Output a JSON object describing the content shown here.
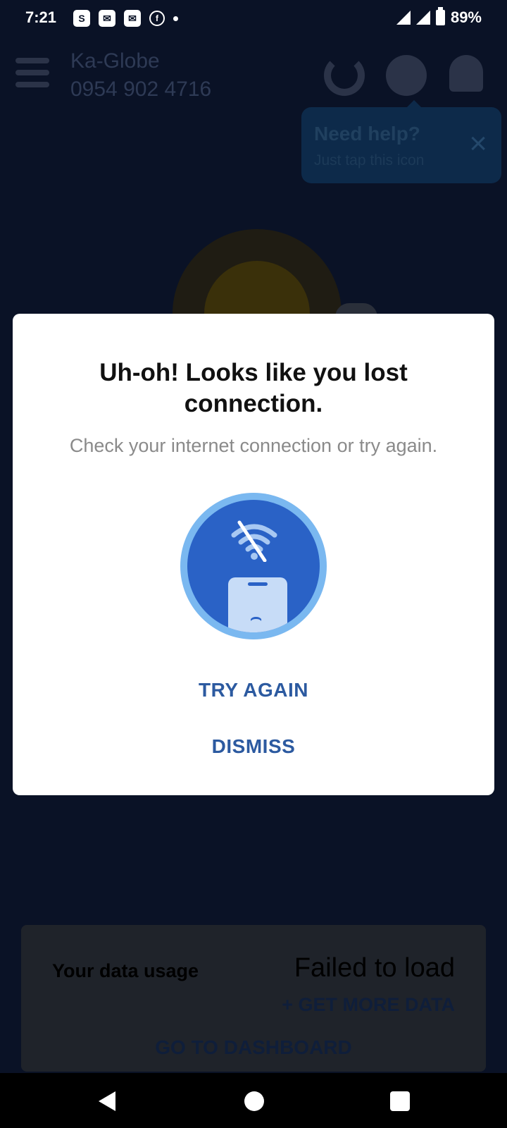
{
  "status_bar": {
    "time": "7:21",
    "battery": "89%"
  },
  "header": {
    "account_name": "Ka-Globe",
    "account_number": "0954 902 4716"
  },
  "tooltip": {
    "title": "Need help?",
    "subtitle": "Just tap this icon"
  },
  "usage_card": {
    "label": "Your data usage",
    "value": "Failed to load",
    "get_more": "+ GET MORE DATA",
    "dashboard": "GO TO DASHBOARD"
  },
  "dialog": {
    "title": "Uh-oh! Looks like you lost connection.",
    "subtitle": "Check your internet connection or try again.",
    "try_again": "TRY AGAIN",
    "dismiss": "DISMISS",
    "frown": "⌢"
  },
  "colors": {
    "overlay_bg": "#0a1226",
    "accent_blue": "#2c5aa0",
    "illustration_blue": "#2a62c6"
  }
}
